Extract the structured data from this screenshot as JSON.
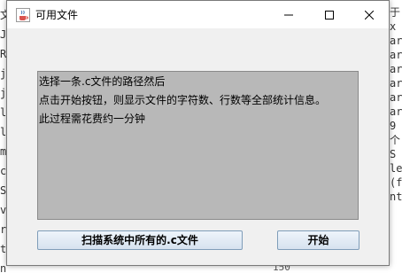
{
  "background": {
    "left_glyphs": [
      "文",
      "J",
      "R",
      "jo",
      "j",
      "lo",
      "ln",
      "m",
      "c",
      "S",
      "v",
      "r",
      "t",
      "n"
    ],
    "right_glyphs": [
      "于",
      "x",
      "ar",
      "ar",
      "ar",
      "ar",
      "ar",
      "ar",
      "9",
      "个",
      "",
      "S",
      "le",
      "",
      "",
      "",
      "(f",
      "nt",
      "",
      "",
      ""
    ],
    "bottom_text": "150"
  },
  "window": {
    "title": "可用文件",
    "icon": "java-cup-icon",
    "controls": {
      "minimize_icon": "minimize-icon",
      "maximize_icon": "maximize-icon",
      "close_icon": "close-icon"
    }
  },
  "text_area": {
    "lines": [
      "选择一条.c文件的路径然后",
      "点击开始按钮，则显示文件的字符数、行数等全部统计信息。",
      "此过程需花费约一分钟"
    ]
  },
  "buttons": {
    "scan_label": "扫描系统中所有的.c文件",
    "start_label": "开始"
  },
  "colors": {
    "text_area_bg": "#b8b8b8",
    "window_bg": "#f0f0f0",
    "button_border": "#7f9db9"
  }
}
